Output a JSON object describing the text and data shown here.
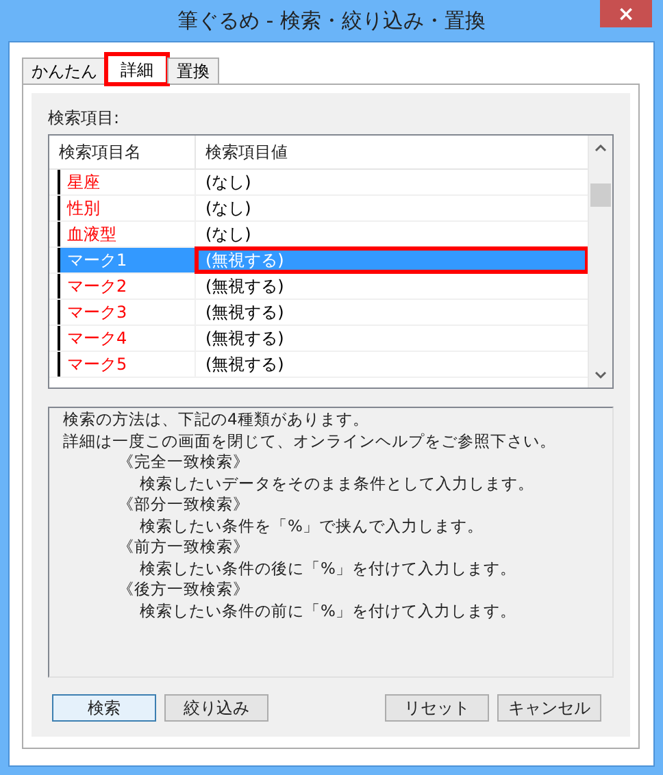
{
  "window": {
    "title": "筆ぐるめ - 検索・絞り込み・置換",
    "close": "×"
  },
  "tabs": [
    {
      "label": "かんたん",
      "selected": false,
      "highlighted": false
    },
    {
      "label": "詳細",
      "selected": true,
      "highlighted": true
    },
    {
      "label": "置換",
      "selected": false,
      "highlighted": false
    }
  ],
  "list_label": "検索項目:",
  "table": {
    "columns": [
      "検索項目名",
      "検索項目値"
    ],
    "rows": [
      {
        "name": "星座",
        "value": "(なし)",
        "selected": false,
        "highlighted": false
      },
      {
        "name": "性別",
        "value": "(なし)",
        "selected": false,
        "highlighted": false
      },
      {
        "name": "血液型",
        "value": "(なし)",
        "selected": false,
        "highlighted": false
      },
      {
        "name": "マーク1",
        "value": "(無視する)",
        "selected": true,
        "highlighted": true
      },
      {
        "name": "マーク2",
        "value": "(無視する)",
        "selected": false,
        "highlighted": false
      },
      {
        "name": "マーク3",
        "value": "(無視する)",
        "selected": false,
        "highlighted": false
      },
      {
        "name": "マーク4",
        "value": "(無視する)",
        "selected": false,
        "highlighted": false
      },
      {
        "name": "マーク5",
        "value": "(無視する)",
        "selected": false,
        "highlighted": false
      }
    ]
  },
  "help": [
    {
      "kind": "text",
      "text": "検索の方法は、下記の4種類があります。"
    },
    {
      "kind": "text",
      "text": "詳細は一度この画面を閉じて、オンラインヘルプをご参照下さい。"
    },
    {
      "kind": "method",
      "text": "《完全一致検索》"
    },
    {
      "kind": "detail",
      "text": "検索したいデータをそのまま条件として入力します。"
    },
    {
      "kind": "method",
      "text": "《部分一致検索》"
    },
    {
      "kind": "detail",
      "text": "検索したい条件を「%」で挟んで入力します。"
    },
    {
      "kind": "method",
      "text": "《前方一致検索》"
    },
    {
      "kind": "detail",
      "text": "検索したい条件の後に「%」を付けて入力します。"
    },
    {
      "kind": "method",
      "text": "《後方一致検索》"
    },
    {
      "kind": "detail",
      "text": "検索したい条件の前に「%」を付けて入力します。"
    }
  ],
  "buttons": [
    {
      "label": "検索",
      "default": true
    },
    {
      "label": "絞り込み",
      "default": false
    },
    {
      "label": "リセット",
      "default": false
    },
    {
      "label": "キャンセル",
      "default": false
    }
  ]
}
